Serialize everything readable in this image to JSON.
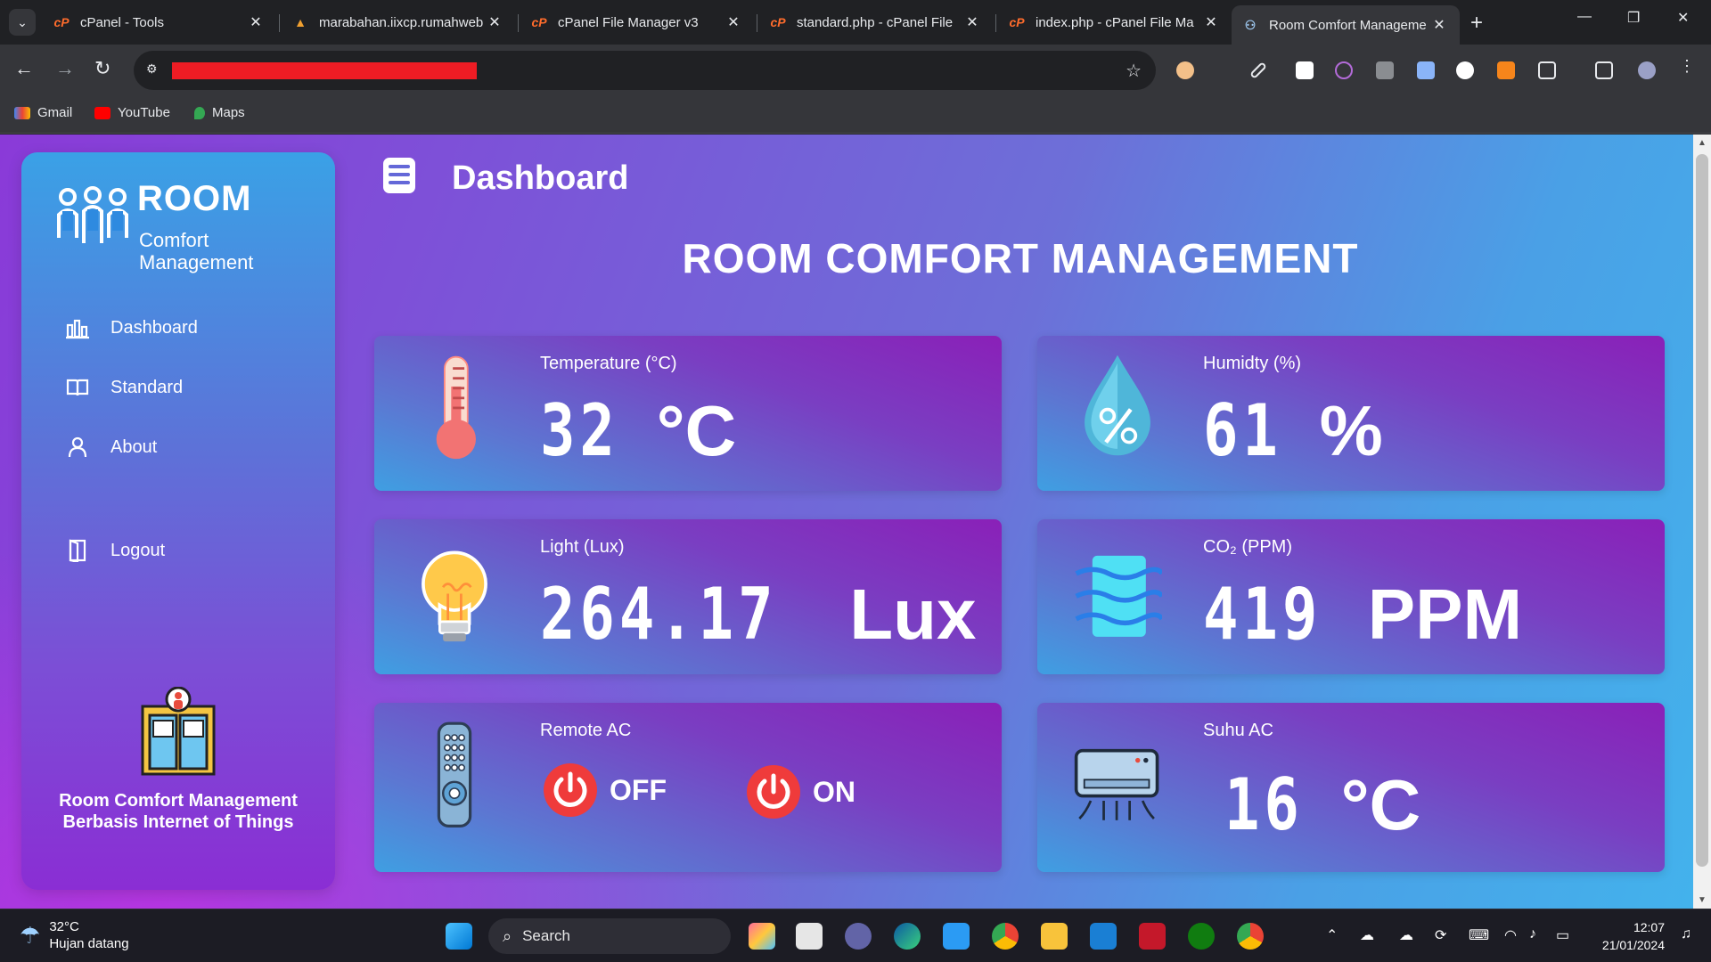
{
  "browser": {
    "tabs": [
      {
        "title": "cPanel - Tools",
        "favicon": "cpanel-icon"
      },
      {
        "title": "marabahan.iixcp.rumahweb",
        "favicon": "rumahweb-icon"
      },
      {
        "title": "cPanel File Manager v3",
        "favicon": "cpanel-icon"
      },
      {
        "title": "standard.php - cPanel File",
        "favicon": "cpanel-icon"
      },
      {
        "title": "index.php - cPanel File Ma",
        "favicon": "cpanel-icon"
      },
      {
        "title": "Room Comfort Manageme",
        "favicon": "room-comfort-icon"
      }
    ],
    "bookmarks": [
      {
        "label": "Gmail"
      },
      {
        "label": "YouTube"
      },
      {
        "label": "Maps"
      }
    ]
  },
  "sidebar": {
    "logo_title": "ROOM",
    "logo_line1": "Comfort",
    "logo_line2": "Management",
    "nav": [
      {
        "label": "Dashboard",
        "icon": "bar-chart-icon"
      },
      {
        "label": "Standard",
        "icon": "book-icon"
      },
      {
        "label": "About",
        "icon": "user-icon"
      },
      {
        "label": "Logout",
        "icon": "door-icon"
      }
    ],
    "footer_text": "Room Comfort Management Berbasis Internet of Things"
  },
  "header": {
    "page_title": "Dashboard",
    "main_title": "ROOM COMFORT MANAGEMENT"
  },
  "cards": {
    "temperature": {
      "label": "Temperature (°C)",
      "value": "32",
      "unit": "°C"
    },
    "humidity": {
      "label": "Humidty (%)",
      "value": "61",
      "unit": "%"
    },
    "light": {
      "label": "Light (Lux)",
      "value": "264.17",
      "unit": "Lux"
    },
    "co2": {
      "label": "CO₂ (PPM)",
      "value": "419",
      "unit": "PPM"
    },
    "remote": {
      "label": "Remote AC",
      "off_label": "OFF",
      "on_label": "ON"
    },
    "ac_temp": {
      "label": "Suhu AC",
      "value": "16",
      "unit": "°C"
    }
  },
  "taskbar": {
    "weather_temp": "32°C",
    "weather_desc": "Hujan datang",
    "search_label": "Search",
    "time": "12:07",
    "date": "21/01/2024"
  },
  "colors": {
    "accent_purple": "#8a3ad8",
    "accent_blue": "#43b2ec",
    "power_red": "#ef3b3b"
  }
}
